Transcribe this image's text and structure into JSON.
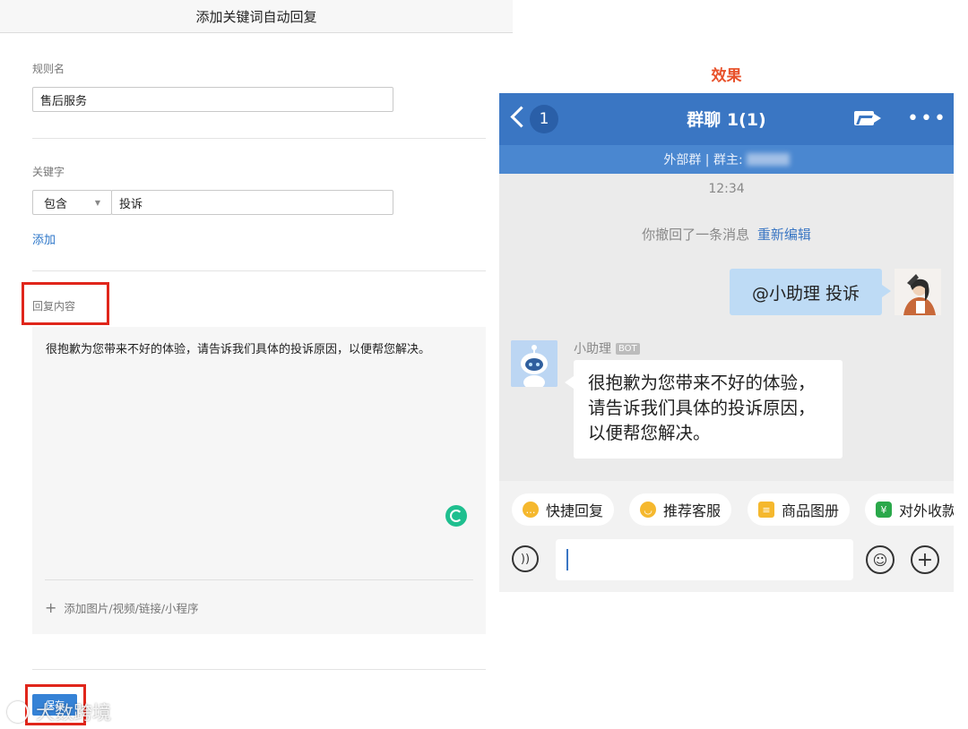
{
  "form": {
    "header_title": "添加关键词自动回复",
    "rule_name_label": "规则名",
    "rule_name_value": "售后服务",
    "keyword_label": "关键字",
    "match_type": "包含",
    "keyword_value": "投诉",
    "add_keyword_link": "添加",
    "reply_label": "回复内容",
    "reply_text": "很抱歉为您带来不好的体验，请告诉我们具体的投诉原因，以便帮您解决。",
    "add_media_label": "添加图片/视频/链接/小程序",
    "save_label": "保存",
    "watermark": "大数跨境"
  },
  "preview": {
    "effect_title": "效果",
    "unread_count": "1",
    "chat_title": "群聊 1(1)",
    "subtitle": "外部群 | 群主:",
    "timestamp": "12:34",
    "recall_notice": "你撤回了一条消息",
    "reedit_link": "重新编辑",
    "user_message": "@小助理 投诉",
    "bot_name": "小助理",
    "bot_badge": "BOT",
    "bot_reply": "很抱歉为您带来不好的体验，请告诉我们具体的投诉原因，以便帮您解决。",
    "quick_replies": [
      {
        "label": "快捷回复",
        "icon": "chat-bubble-icon",
        "color": "#f5b82e"
      },
      {
        "label": "推荐客服",
        "icon": "service-icon",
        "color": "#f5b82e"
      },
      {
        "label": "商品图册",
        "icon": "catalog-icon",
        "color": "#f5b82e"
      },
      {
        "label": "对外收款",
        "icon": "yuan-shield-icon",
        "color": "#2aa84a"
      }
    ]
  },
  "colors": {
    "accent_blue": "#3a76c3",
    "highlight_red": "#e0261b",
    "effect_orange": "#e8512a",
    "user_bubble": "#bedbf5"
  }
}
